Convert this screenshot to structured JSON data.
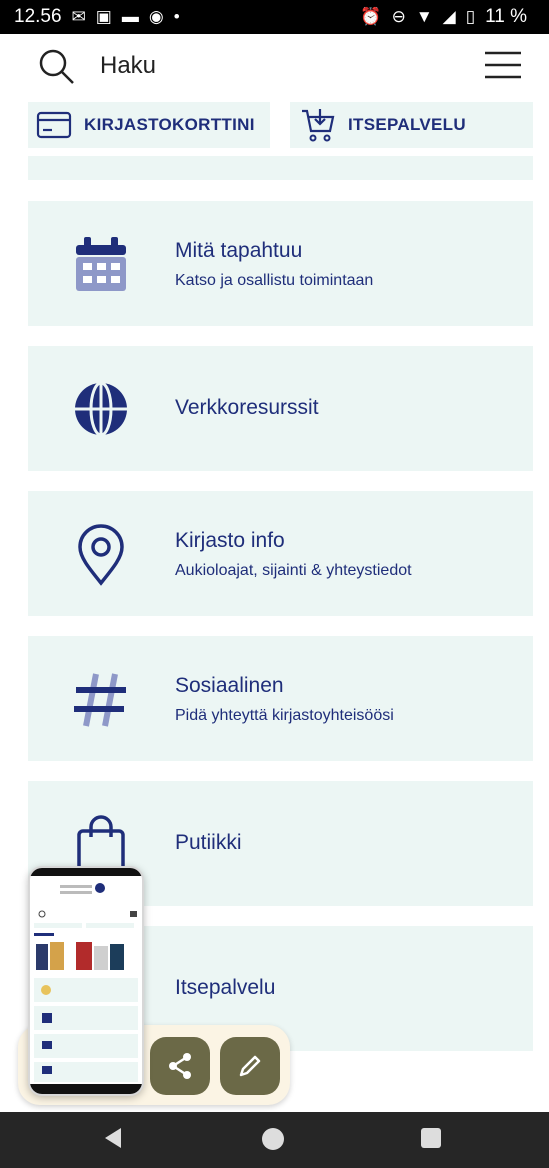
{
  "status_bar": {
    "time": "12.56",
    "battery": "11 %"
  },
  "header": {
    "search_label": "Haku"
  },
  "quick_links": [
    {
      "label": "KIRJASTOKORTTINI",
      "icon": "library-card-icon"
    },
    {
      "label": "ITSEPALVELU",
      "icon": "cart-icon"
    }
  ],
  "tiles": [
    {
      "title": "Mitä tapahtuu",
      "subtitle": "Katso ja osallistu toimintaan",
      "icon": "calendar-icon"
    },
    {
      "title": "Verkkoresurssit",
      "icon": "globe-icon"
    },
    {
      "title": "Kirjasto info",
      "subtitle": "Aukioloajat, sijainti & yhteystiedot",
      "icon": "location-pin-icon"
    },
    {
      "title": "Sosiaalinen",
      "subtitle": "Pidä yhteyttä kirjastoyhteisöösi",
      "icon": "hashtag-icon"
    },
    {
      "title": "Putiikki",
      "icon": "shopping-bag-icon"
    },
    {
      "title": "Itsepalvelu",
      "icon": "self-service-icon"
    }
  ],
  "colors": {
    "accent": "#1f2e7a",
    "tile_bg": "#ecf6f4",
    "fab": "#6b6947"
  }
}
